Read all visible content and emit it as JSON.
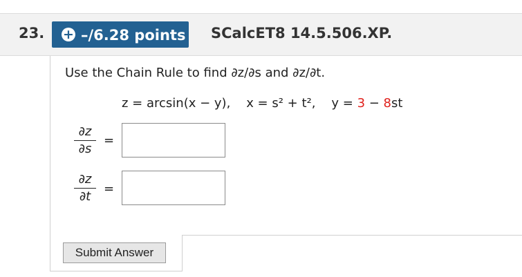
{
  "question": {
    "number": "23.",
    "points_label": "–/6.28 points",
    "assignment_code": "SCalcET8 14.5.506.XP."
  },
  "body": {
    "prompt": "Use the Chain Rule to find ∂z/∂s and ∂z/∂t.",
    "equation": {
      "z_def": "z = arcsin(x − y),",
      "x_def": "x = s² + t²,",
      "y_def_prefix": "y = ",
      "y_def_red1": "3",
      "y_def_mid": " − ",
      "y_def_red2": "8",
      "y_def_suffix": "st"
    },
    "answers": [
      {
        "numerator": "∂z",
        "denominator": "∂s",
        "equals": "=",
        "value": ""
      },
      {
        "numerator": "∂z",
        "denominator": "∂t",
        "equals": "=",
        "value": ""
      }
    ]
  },
  "submit_label": "Submit Answer",
  "colors": {
    "badge": "#236192",
    "highlight_red": "#e0201b",
    "header_bg": "#f2f2f2"
  }
}
